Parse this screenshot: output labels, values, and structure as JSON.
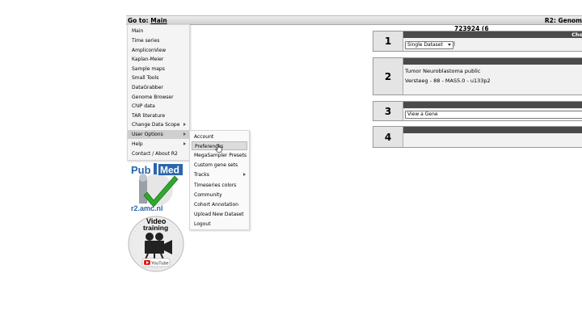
{
  "topbar": {
    "goto_label": "Go to:",
    "goto_link": "Main",
    "r2_title": "R2: Genom"
  },
  "count_text": "723924 (6",
  "menu": {
    "items": [
      {
        "label": "Main",
        "submenu": false
      },
      {
        "label": "Time series",
        "submenu": false
      },
      {
        "label": "AmpliconView",
        "submenu": false
      },
      {
        "label": "Kaplan-Meier",
        "submenu": false
      },
      {
        "label": "Sample maps",
        "submenu": false
      },
      {
        "label": "Small Tools",
        "submenu": false
      },
      {
        "label": "DataGrabber",
        "submenu": false
      },
      {
        "label": "Genome Browser",
        "submenu": false
      },
      {
        "label": "ChIP data",
        "submenu": false
      },
      {
        "label": "TAR literature",
        "submenu": false
      },
      {
        "label": "Change Data Scope",
        "submenu": true
      },
      {
        "label": "User Options",
        "submenu": true,
        "active": true
      },
      {
        "label": "Help",
        "submenu": true
      },
      {
        "label": "Contact / About R2",
        "submenu": false
      }
    ]
  },
  "submenu": {
    "items": [
      {
        "label": "Account"
      },
      {
        "label": "Preferences",
        "hover": true
      },
      {
        "label": "MegaSampler Presets"
      },
      {
        "label": "Custom gene sets"
      },
      {
        "label": "Tracks",
        "submenu": true
      },
      {
        "label": "Timeseries colors"
      },
      {
        "label": "Community"
      },
      {
        "label": "Cohort Annotation"
      },
      {
        "label": "Upload New Dataset"
      },
      {
        "label": "Logout"
      }
    ]
  },
  "pubmed_logo": {
    "text_pub": "Pub",
    "text_med": "Med",
    "caption": "r2.amc.nl"
  },
  "video_logo": {
    "line1": "Video",
    "line2": "training",
    "badge": "YouTube"
  },
  "steps": [
    {
      "number": "1",
      "header": "Cho",
      "select_value": "Single Dataset",
      "extra": "|"
    },
    {
      "number": "2",
      "line1": "Tumor Neuroblastoma public",
      "line2": "Versteeg - 88 - MAS5.0 - u133p2"
    },
    {
      "number": "3",
      "select_value": "View a Gene"
    },
    {
      "number": "4"
    }
  ],
  "colors": {
    "header_dark": "#4a4a4a",
    "pubmed_blue": "#2a66ad",
    "check_green": "#2ea82e",
    "youtube_red": "#e01b1b"
  }
}
